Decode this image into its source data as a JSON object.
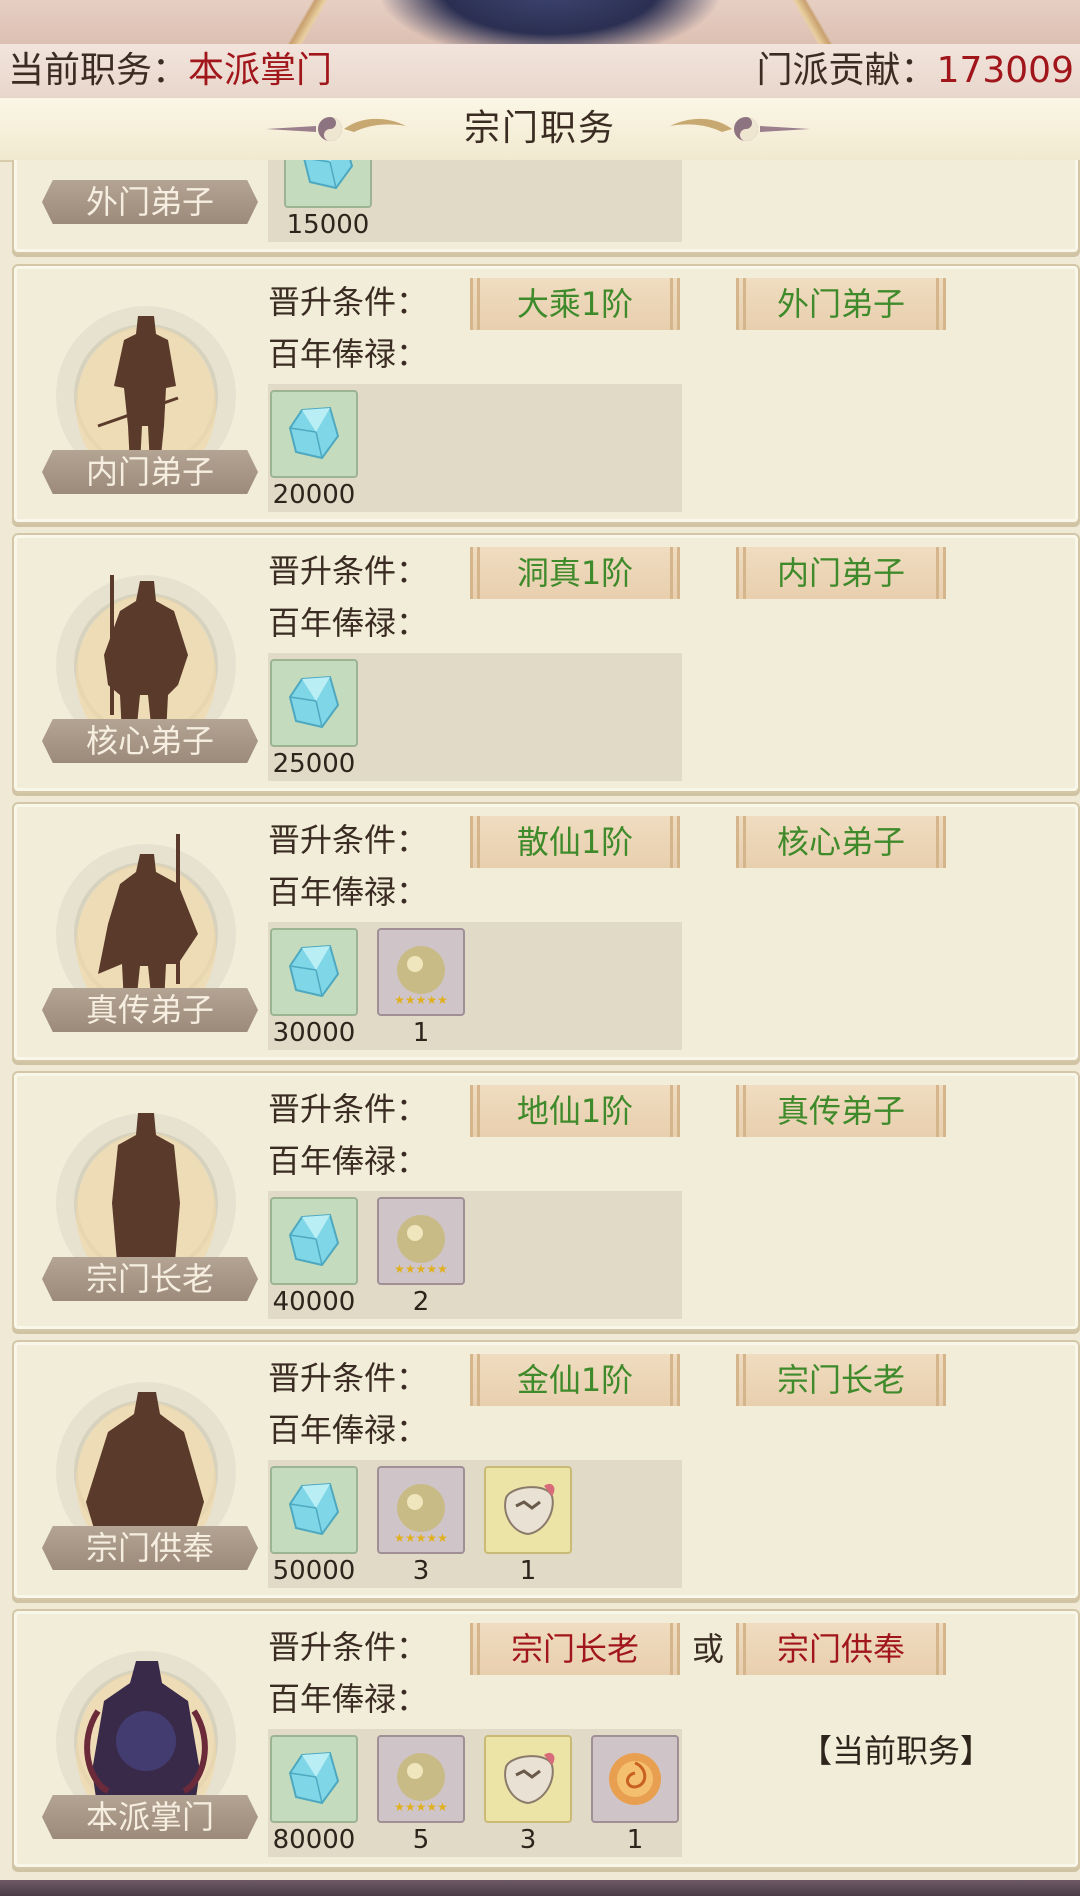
{
  "header": {
    "position_label": "当前职务：",
    "position_value": "本派掌门",
    "contribution_label": "门派贡献：",
    "contribution_value": "173009",
    "title": "宗门职务"
  },
  "labels": {
    "condition": "晋升条件：",
    "salary": "百年俸禄：",
    "or": "或",
    "current_position": "【当前职务】"
  },
  "ranks": [
    {
      "name": "外门弟子",
      "rewards": [
        {
          "type": "crystal",
          "qty": "15000"
        }
      ]
    },
    {
      "name": "内门弟子",
      "cond1": "大乘1阶",
      "cond2": "外门弟子",
      "rewards": [
        {
          "type": "crystal",
          "qty": "20000"
        }
      ]
    },
    {
      "name": "核心弟子",
      "cond1": "洞真1阶",
      "cond2": "内门弟子",
      "rewards": [
        {
          "type": "crystal",
          "qty": "25000"
        }
      ]
    },
    {
      "name": "真传弟子",
      "cond1": "散仙1阶",
      "cond2": "核心弟子",
      "rewards": [
        {
          "type": "crystal",
          "qty": "30000"
        },
        {
          "type": "orb",
          "qty": "1"
        }
      ]
    },
    {
      "name": "宗门长老",
      "cond1": "地仙1阶",
      "cond2": "真传弟子",
      "rewards": [
        {
          "type": "crystal",
          "qty": "40000"
        },
        {
          "type": "orb",
          "qty": "2"
        }
      ]
    },
    {
      "name": "宗门供奉",
      "cond1": "金仙1阶",
      "cond2": "宗门长老",
      "rewards": [
        {
          "type": "crystal",
          "qty": "50000"
        },
        {
          "type": "orb",
          "qty": "3"
        },
        {
          "type": "badge",
          "qty": "1"
        }
      ]
    },
    {
      "name": "本派掌门",
      "cond1": "宗门长老",
      "cond2": "宗门供奉",
      "rewards": [
        {
          "type": "crystal",
          "qty": "80000"
        },
        {
          "type": "orb",
          "qty": "5"
        },
        {
          "type": "badge",
          "qty": "3"
        },
        {
          "type": "fire",
          "qty": "1"
        }
      ]
    }
  ],
  "icons": {
    "crystal": "blue-crystal-icon",
    "orb": "star-orb-icon",
    "badge": "beast-badge-icon",
    "fire": "flame-orb-icon"
  },
  "colors": {
    "contribution": "#a0161b",
    "condition_met": "#3f8a2a",
    "condition_red": "#a0161b"
  }
}
